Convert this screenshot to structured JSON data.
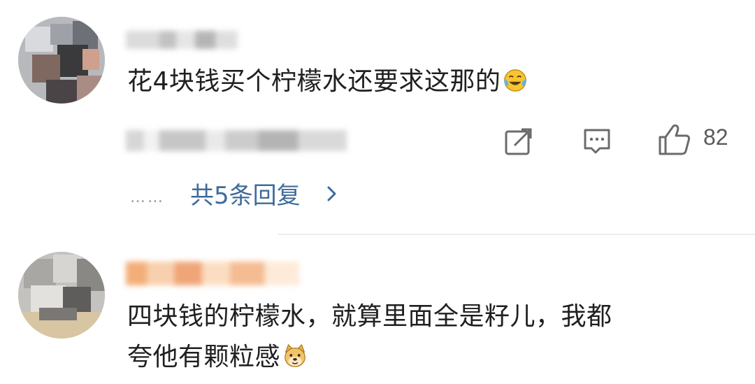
{
  "comments": [
    {
      "text": "花4块钱买个柠檬水还要求这那的",
      "emoji": "laughing-crying-emoji",
      "like_count": "82",
      "replies_label": "共5条回复",
      "replies_dots": "……"
    },
    {
      "line1": "四块钱的柠檬水，就算里面全是籽儿，我都",
      "line2": "夸他有颗粒感",
      "emoji": "doge-emoji"
    }
  ],
  "colors": {
    "link": "#3f6b9a",
    "text": "#1f1f1f",
    "icon": "#6b6b6b"
  }
}
